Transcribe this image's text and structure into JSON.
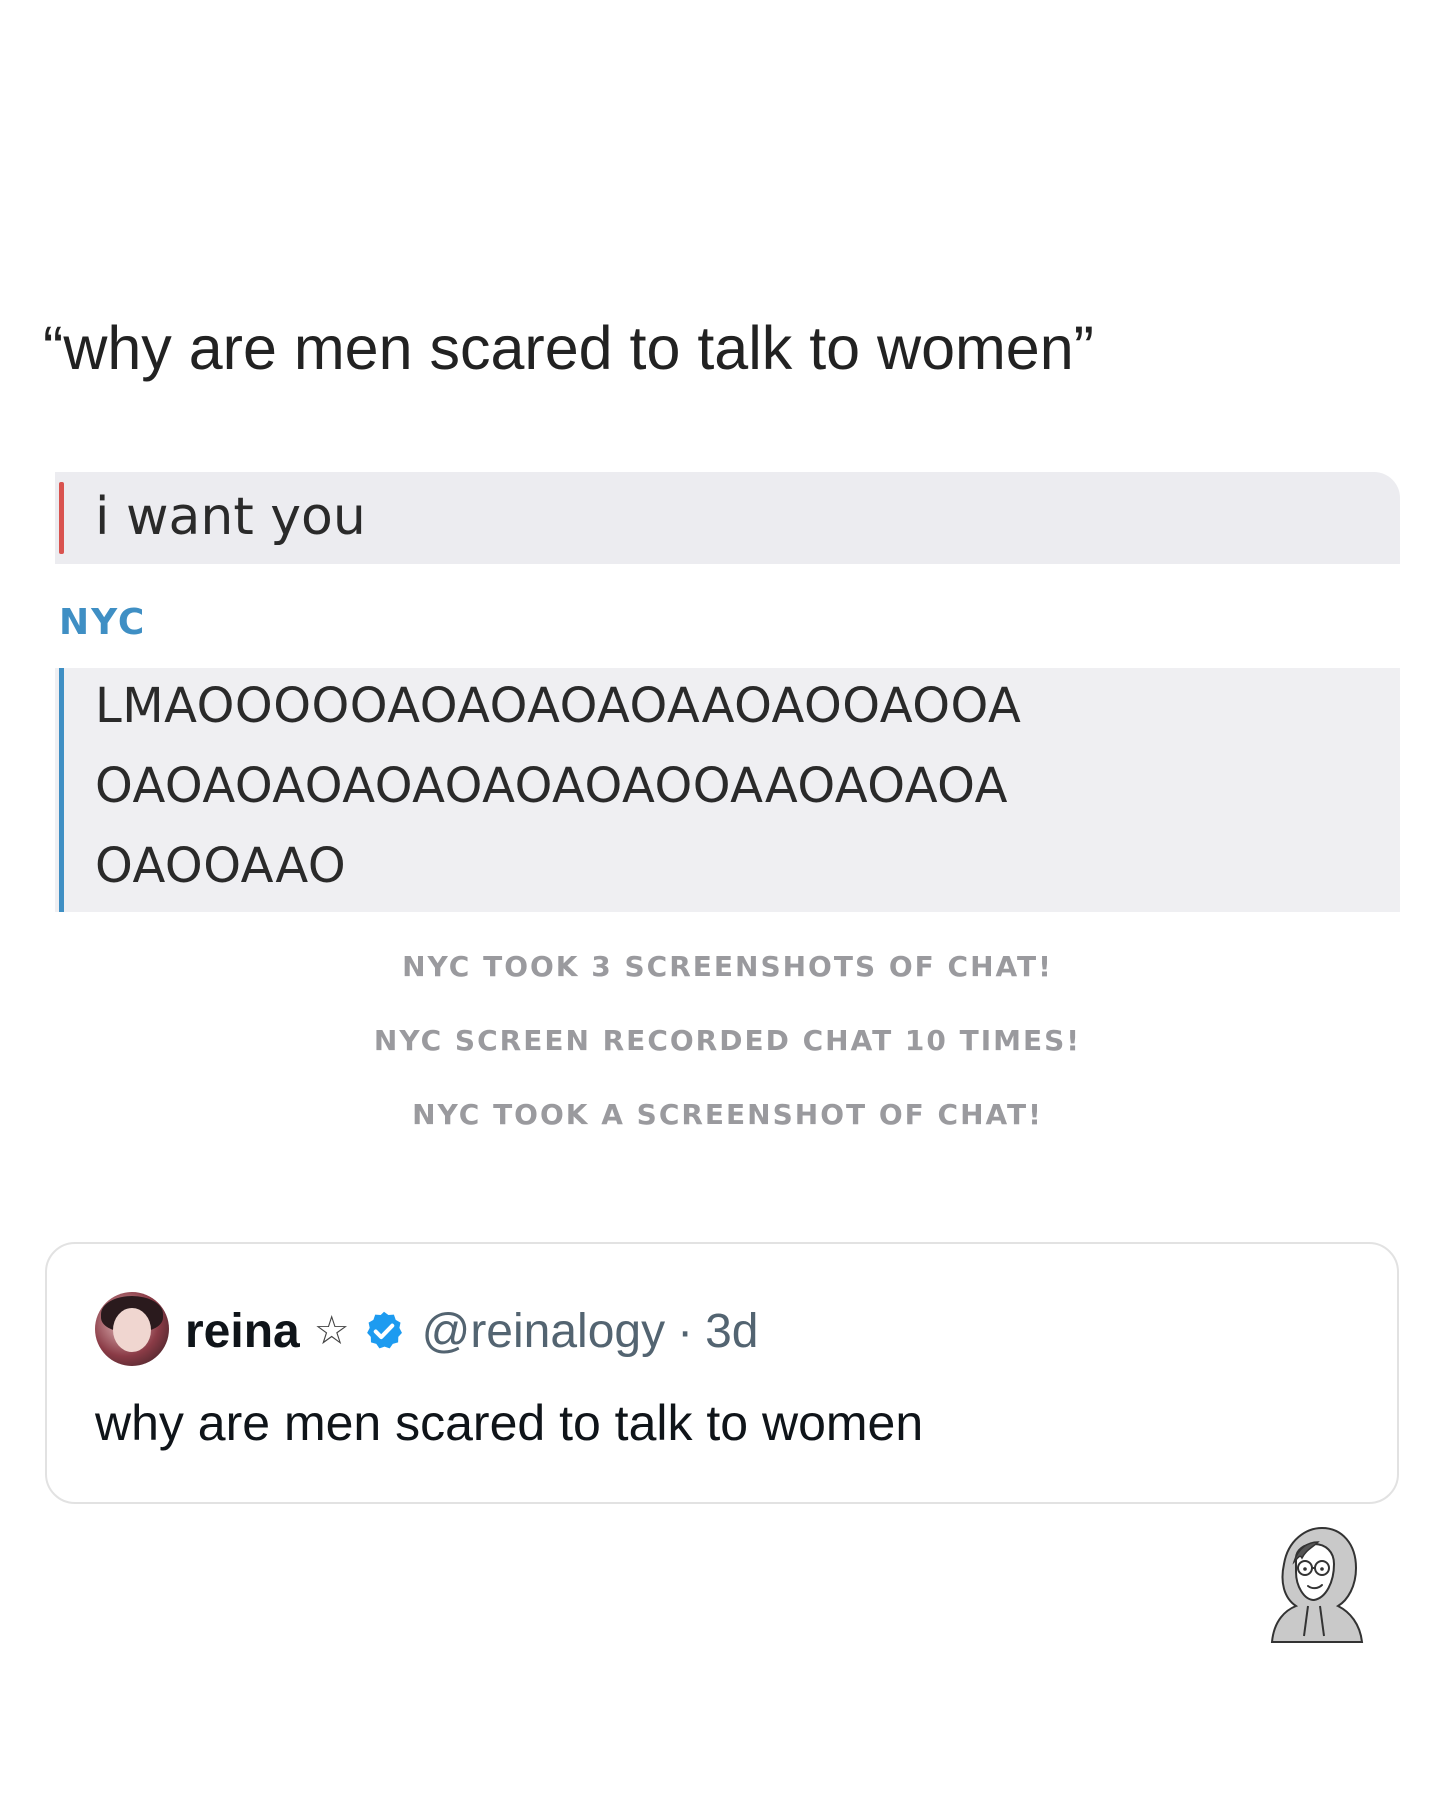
{
  "caption": "“why are men scared to talk to women”",
  "chat": {
    "outgoing_message": "i want you",
    "sender_label": "NYC",
    "incoming_lines": [
      "LMAOOOOOAOAOAOAOAAOAOOAOOA",
      "OAOAOAOAOAOAOAOAOOAAOAOAOA",
      "OAOOAAO"
    ],
    "system_notes": [
      "NYC TOOK 3 SCREENSHOTS OF CHAT!",
      "NYC SCREEN RECORDED CHAT 10 TIMES!",
      "NYC TOOK A SCREENSHOT OF CHAT!"
    ],
    "colors": {
      "outgoing_bar": "#d9534f",
      "incoming_bar": "#3f8fc4",
      "sender_label": "#3f8fc4"
    }
  },
  "tweet": {
    "name": "reina",
    "star": "☆",
    "handle": "@reinalogy",
    "separator": "·",
    "time": "3d",
    "body": "why are men scared to talk to women",
    "icons": [
      "avatar",
      "star-icon",
      "verified-badge-icon"
    ],
    "colors": {
      "verified": "#1d9bf0",
      "handle": "#536471"
    }
  },
  "watermark": {
    "icon": "hooded-cartoon-character-icon"
  }
}
